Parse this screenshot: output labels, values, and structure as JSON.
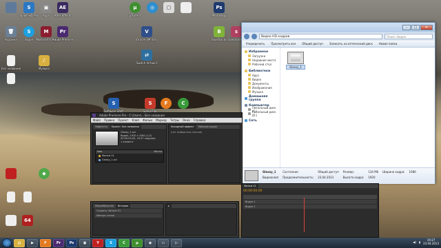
{
  "desktop": {
    "icons": [
      {
        "name": "icon-recycle-top",
        "label": "",
        "glyph": "",
        "color": "#5d7a9a"
      },
      {
        "name": "icon-splashhd",
        "label": "SplashHD Pro",
        "glyph": "S",
        "color": "#2b78c4"
      },
      {
        "name": "icon-apps",
        "label": "Apps",
        "glyph": "▣",
        "color": "#888"
      },
      {
        "name": "icon-after-effects",
        "label": "After Effects",
        "glyph": "AE",
        "color": "#3a2a60"
      },
      {
        "name": "icon-recycle",
        "label": "Корзина",
        "glyph": "🗑",
        "color": "#6b7f95"
      },
      {
        "name": "icon-skype",
        "label": "Skype",
        "glyph": "S",
        "color": "#1ca0e0"
      },
      {
        "name": "icon-motion",
        "label": "MotionVFX Pro",
        "glyph": "M",
        "color": "#8a1e30"
      },
      {
        "name": "icon-premiere",
        "label": "Adobe Premiere Pro",
        "glyph": "Pr",
        "color": "#4a2a70"
      },
      {
        "name": "icon-file",
        "label": "Без названия",
        "glyph": "",
        "color": "#f0f0f0"
      },
      {
        "name": "icon-music",
        "label": "Музыка",
        "glyph": "♪",
        "color": "#d8b040"
      },
      {
        "name": "icon-utorrent",
        "label": "μTorrent",
        "glyph": "μ",
        "color": "#3f8f2f"
      },
      {
        "name": "icon-uplay",
        "label": "",
        "glyph": "◎",
        "color": "#2d8ed0"
      },
      {
        "name": "icon-unknown",
        "label": "",
        "glyph": "▢",
        "color": "#ddd"
      },
      {
        "name": "icon-photoshop",
        "label": "Photoshop",
        "glyph": "Ps",
        "color": "#1e3a6e"
      },
      {
        "name": "icon-virtualbox",
        "label": "Oracle VM VirtualBox",
        "glyph": "V",
        "color": "#2f4f8a"
      },
      {
        "name": "icon-bluestacks",
        "label": "BlueStacks",
        "glyph": "B",
        "color": "#7fb33a"
      },
      {
        "name": "icon-sumotorrent",
        "label": "Sumotorrent",
        "glyph": "s",
        "color": "#b04060"
      },
      {
        "name": "icon-switch-virtual",
        "label": "Switch Virtual Router",
        "glyph": "⇄",
        "color": "#2f6fa0"
      },
      {
        "name": "icon-softwareshift",
        "label": "Software Shift",
        "glyph": "S",
        "color": "#2560b0"
      },
      {
        "name": "icon-sumoplay",
        "label": "Sumo Play",
        "glyph": "S",
        "color": "#c43a2a"
      },
      {
        "name": "icon-firefox",
        "label": "Firefox",
        "glyph": "F",
        "color": "#e47a20"
      },
      {
        "name": "icon-chrome",
        "label": "Chrome",
        "glyph": "C",
        "color": "#3a9a3a"
      },
      {
        "name": "icon-green-ball",
        "label": "",
        "glyph": "◆",
        "color": "#4fa84a"
      },
      {
        "name": "icon-red-square",
        "label": "",
        "glyph": "",
        "color": "#c02020"
      },
      {
        "name": "icon-document",
        "label": "",
        "glyph": "",
        "color": "#f0f0f0"
      },
      {
        "name": "icon-64",
        "label": "",
        "glyph": "64",
        "color": "#b02020"
      }
    ]
  },
  "explorer": {
    "address": "Видео HD кадров",
    "search_placeholder": "Поиск: Видео",
    "toolbar": [
      "Упорядочить",
      "Просмотреть все",
      "Общий доступ",
      "Записать на оптический диск",
      "Новая папка"
    ],
    "nav": {
      "favorites": {
        "label": "Избранное",
        "items": [
          "Загрузки",
          "Недавние места",
          "Рабочий стол"
        ]
      },
      "libraries": {
        "label": "Библиотеки",
        "items": [
          "Apps",
          "Видео",
          "Документы",
          "Изображения",
          "Музыка"
        ]
      },
      "homegroup": "Домашняя группа",
      "computer": {
        "label": "Компьютер",
        "items": [
          "Локальный диск (C:)",
          "Локальный диск (D:)"
        ]
      },
      "network": "Сеть"
    },
    "file": {
      "name": "Glossy_1"
    },
    "details": {
      "name": "Glossy_1",
      "type": "Видеоклип",
      "state_label": "Состояние:",
      "state": "Общий доступ",
      "size_label": "Размер:",
      "size": "134 Мб",
      "frame_w_label": "Ширина кадра:",
      "frame_w": "1080",
      "frame_h_label": "Высота кадра:",
      "frame_h": "1920",
      "preview_label": "Продолжительность:",
      "date": "23.04.2013"
    }
  },
  "premiere": {
    "title": "Adobe Premiere Pro - C:\\Users\\...\\Без названия",
    "menu": [
      "Файл",
      "Правка",
      "Проект",
      "Клип",
      "Фильм",
      "Маркер",
      "Титры",
      "Окно",
      "Справка"
    ],
    "project_tabs": [
      "Эффекты",
      "Проект: Без названия"
    ],
    "clip_name": "Glossy_1.avi",
    "clip_info": [
      "Видео, 1920 x 1080 (1,0)",
      "00:00:05:00, 29,97 кадров/с"
    ],
    "item_count": "1 элемент",
    "list_headers": [
      "Имя",
      "Метка"
    ],
    "list_rows": [
      "Фильм 01",
      "Glossy_1.avi"
    ],
    "monitor_tabs": [
      "Исходный эффект",
      "Микшер аудио"
    ],
    "monitor_text": "(нет выбранных клипов)",
    "lower_tabs": [
      "Медиабраузер",
      "История"
    ],
    "lower_rows": [
      "Создать: Фильм 01",
      "Импорт клипа"
    ],
    "timeline_tab": "Фильм 01",
    "timecode": "00:00:00:00",
    "tracks": [
      "Видео 1",
      "Видео 1"
    ]
  },
  "taskbar": {
    "items": [
      "Проводник",
      "Media",
      "Firefox",
      "Premiere",
      "Photoshop",
      "Torrent",
      "Yandex",
      "Skype",
      "Chrome",
      "uTorrent",
      "Steam",
      "Folder",
      "Media2"
    ],
    "time": "19:27",
    "date": "23.04.2013"
  }
}
